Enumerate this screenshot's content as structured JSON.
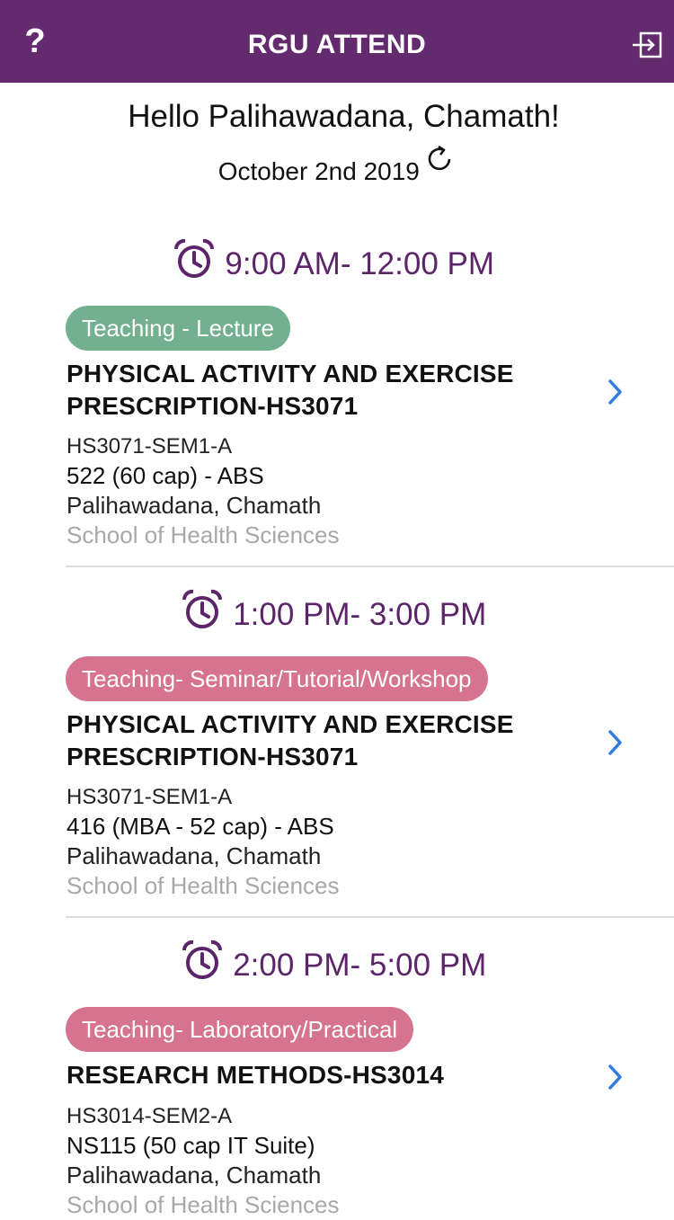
{
  "header": {
    "title": "RGU ATTEND",
    "help_label": "?",
    "background": "#632a6e"
  },
  "greeting": "Hello Palihawadana, Chamath!",
  "date": "October 2nd 2019",
  "icons": {
    "refresh": "refresh-icon",
    "alarm": "alarm-clock-icon",
    "chevron": "chevron-right-icon",
    "logout": "logout-icon"
  },
  "sessions": [
    {
      "time": "9:00 AM- 12:00 PM",
      "type": "Teaching - Lecture",
      "type_color": "#72b08f",
      "course": "PHYSICAL ACTIVITY AND EXERCISE PRESCRIPTION-HS3071",
      "course_lines": [
        "PHYSICAL ACTIVITY AND EXERCISE",
        "PRESCRIPTION-HS3071"
      ],
      "module_code": "HS3071-SEM1-A",
      "room": "522 (60 cap) - ABS",
      "lecturer": "Palihawadana, Chamath",
      "school": "School of Health Sciences"
    },
    {
      "time": "1:00 PM- 3:00 PM",
      "type": "Teaching- Seminar/Tutorial/Workshop",
      "type_color": "#d6738f",
      "course": "PHYSICAL ACTIVITY AND EXERCISE PRESCRIPTION-HS3071",
      "course_lines": [
        "PHYSICAL ACTIVITY AND EXERCISE",
        "PRESCRIPTION-HS3071"
      ],
      "module_code": "HS3071-SEM1-A",
      "room": "416 (MBA - 52 cap) - ABS",
      "lecturer": "Palihawadana, Chamath",
      "school": "School of Health Sciences"
    },
    {
      "time": "2:00 PM- 5:00 PM",
      "type": "Teaching- Laboratory/Practical",
      "type_color": "#d6738f",
      "course": "RESEARCH METHODS-HS3014",
      "course_lines": [
        "RESEARCH METHODS-HS3014"
      ],
      "module_code": "HS3014-SEM2-A",
      "room": "NS115 (50 cap IT Suite)",
      "lecturer": "Palihawadana, Chamath",
      "school": "School of Health Sciences"
    }
  ],
  "colors": {
    "accent": "#5c2569",
    "chevron": "#2f7be0",
    "divider": "#dcdcdc",
    "muted_text": "#a8a8a8"
  }
}
